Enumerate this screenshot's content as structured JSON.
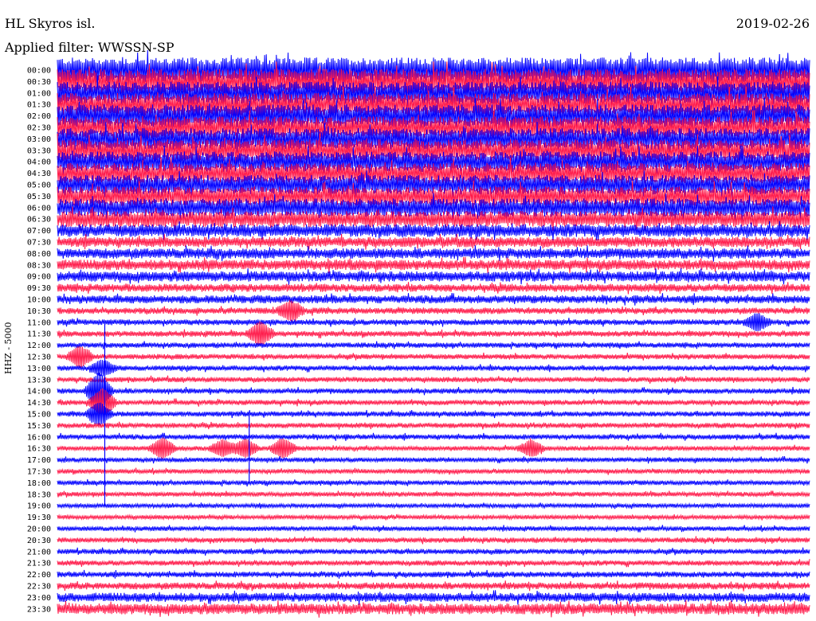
{
  "header": {
    "station": "HL Skyros isl.",
    "date": "2019-02-26",
    "filter": "Applied filter: WWSSN-SP"
  },
  "chart_data": {
    "type": "line",
    "title": "HL Skyros isl.",
    "subtitle": "Applied filter: WWSSN-SP",
    "ylabel": "HHZ - 5000",
    "xlabel": "",
    "x_unit": "",
    "row_labels": [
      "00:00",
      "00:30",
      "01:00",
      "01:30",
      "02:00",
      "02:30",
      "03:00",
      "03:30",
      "04:00",
      "04:30",
      "05:00",
      "05:30",
      "06:00",
      "06:30",
      "07:00",
      "07:30",
      "08:00",
      "08:30",
      "09:00",
      "09:30",
      "10:00",
      "10:30",
      "11:00",
      "11:30",
      "12:00",
      "12:30",
      "13:00",
      "13:30",
      "14:00",
      "14:30",
      "15:00",
      "15:30",
      "16:00",
      "16:30",
      "17:00",
      "17:30",
      "18:00",
      "18:30",
      "19:00",
      "19:30",
      "20:00",
      "20:30",
      "21:00",
      "21:30",
      "22:00",
      "22:30",
      "23:00",
      "23:30"
    ],
    "colors": {
      "even_rows": "#0000ff",
      "odd_rows": "#ff1a4a"
    },
    "row_amplitude": [
      2.2,
      2.2,
      2.0,
      2.0,
      2.0,
      1.9,
      1.9,
      1.9,
      1.8,
      1.8,
      1.7,
      1.7,
      1.6,
      1.4,
      1.1,
      0.9,
      0.9,
      0.9,
      0.9,
      0.7,
      0.7,
      0.55,
      0.5,
      0.5,
      0.45,
      0.45,
      0.45,
      0.45,
      0.45,
      0.45,
      0.45,
      0.45,
      0.45,
      0.4,
      0.4,
      0.4,
      0.4,
      0.4,
      0.35,
      0.35,
      0.4,
      0.45,
      0.45,
      0.45,
      0.5,
      0.6,
      0.8,
      0.95
    ],
    "events": [
      {
        "row": 21,
        "t": 0.31,
        "amp": 1.5
      },
      {
        "row": 22,
        "t": 0.93,
        "amp": 1.3
      },
      {
        "row": 23,
        "t": 0.27,
        "amp": 1.8
      },
      {
        "row": 25,
        "t": 0.03,
        "amp": 1.6
      },
      {
        "row": 26,
        "t": 0.06,
        "amp": 1.2
      },
      {
        "row": 28,
        "t": 0.055,
        "amp": 3.0
      },
      {
        "row": 29,
        "t": 0.06,
        "amp": 2.2
      },
      {
        "row": 30,
        "t": 0.055,
        "amp": 1.8
      },
      {
        "row": 33,
        "t": 0.14,
        "amp": 1.6
      },
      {
        "row": 33,
        "t": 0.22,
        "amp": 1.3
      },
      {
        "row": 33,
        "t": 0.25,
        "amp": 1.4
      },
      {
        "row": 33,
        "t": 0.3,
        "amp": 1.5
      },
      {
        "row": 33,
        "t": 0.63,
        "amp": 1.2
      }
    ],
    "spikes": [
      {
        "row": 27,
        "t": 0.063,
        "up_rows": 5,
        "down_rows": 11
      },
      {
        "row": 33,
        "t": 0.255,
        "up_rows": 3,
        "down_rows": 3
      }
    ],
    "grid": false,
    "legend": "none"
  }
}
